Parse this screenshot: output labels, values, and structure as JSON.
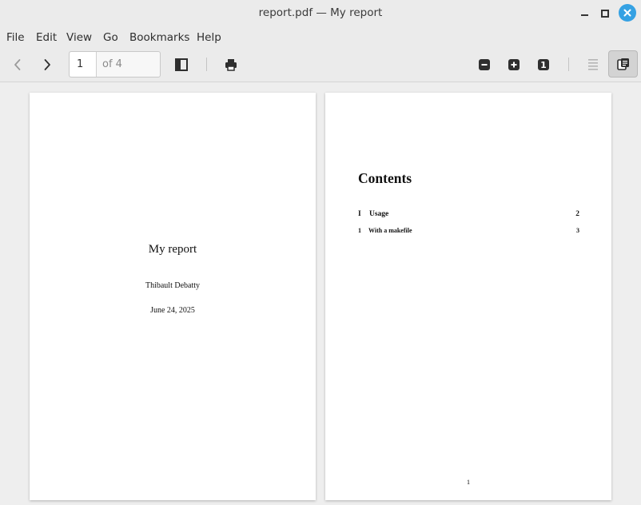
{
  "window": {
    "title": "report.pdf — My report",
    "controls": [
      "minimize-icon",
      "maximize-icon",
      "close-icon"
    ],
    "close_color": "#35a1e3"
  },
  "menubar": {
    "items": [
      "File",
      "Edit",
      "View",
      "Go",
      "Bookmarks",
      "Help"
    ]
  },
  "toolbar": {
    "icons": [
      "chevron-left-icon",
      "chevron-right-icon",
      "sidebar-icon",
      "print-icon",
      "zoom-out-icon",
      "zoom-in-icon",
      "zoom-reset-icon",
      "continuous-view-icon",
      "dual-page-icon"
    ],
    "page_number": "1",
    "page_total": "of 4",
    "zoom_reset_label": "1"
  },
  "document": {
    "title_page": {
      "title": "My report",
      "author": "Thibault Debatty",
      "date": "June 24, 2025"
    },
    "contents_page": {
      "heading": "Contents",
      "entries": [
        {
          "number": "I",
          "label": "Usage",
          "page": "2"
        },
        {
          "number": "1",
          "label": "With a makefile",
          "page": "3"
        }
      ],
      "footer_page_number": "1"
    }
  }
}
